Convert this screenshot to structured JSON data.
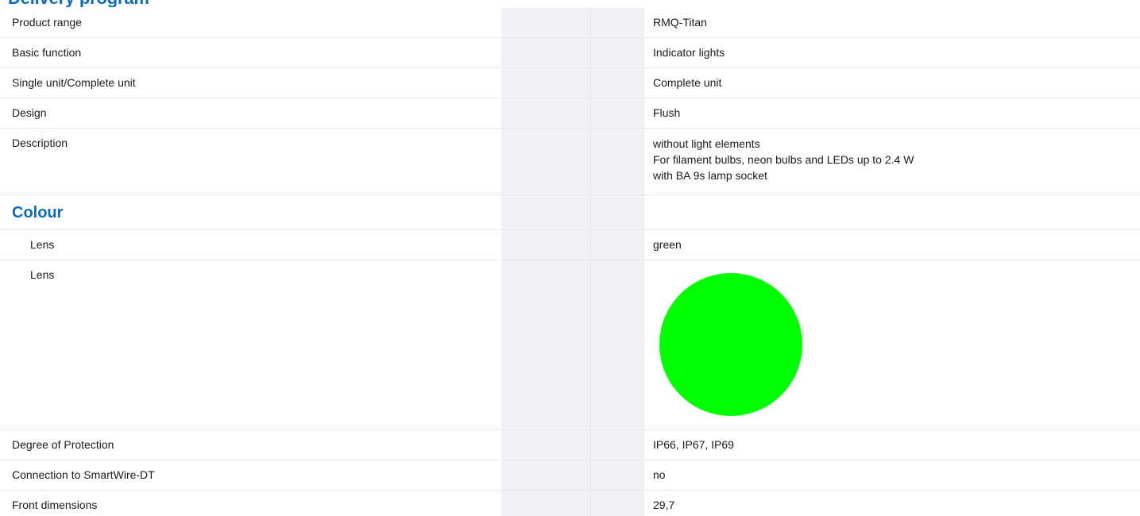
{
  "heading": "Delivery program",
  "rows": {
    "product_range": {
      "label": "Product range",
      "value": "RMQ-Titan"
    },
    "basic_function": {
      "label": "Basic function",
      "value": "Indicator lights"
    },
    "unit": {
      "label": "Single unit/Complete unit",
      "value": "Complete unit"
    },
    "design": {
      "label": "Design",
      "value": "Flush"
    },
    "description": {
      "label": "Description",
      "lines": [
        "without light elements",
        "For filament bulbs, neon bulbs and LEDs up to 2.4 W",
        "with BA 9s lamp socket"
      ]
    },
    "colour_section": {
      "title": "Colour"
    },
    "lens_text": {
      "label": "Lens",
      "value": "green"
    },
    "lens_swatch": {
      "label": "Lens",
      "color": "#00ff00"
    },
    "protection": {
      "label": "Degree of Protection",
      "value": "IP66, IP67, IP69"
    },
    "smartwire": {
      "label": "Connection to SmartWire-DT",
      "value": "no"
    },
    "front_dimensions": {
      "label": "Front dimensions",
      "value": "29,7"
    }
  },
  "colors": {
    "accent": "#0a6cc2",
    "band": "#eff1f6",
    "divider": "#e6e8ee"
  }
}
